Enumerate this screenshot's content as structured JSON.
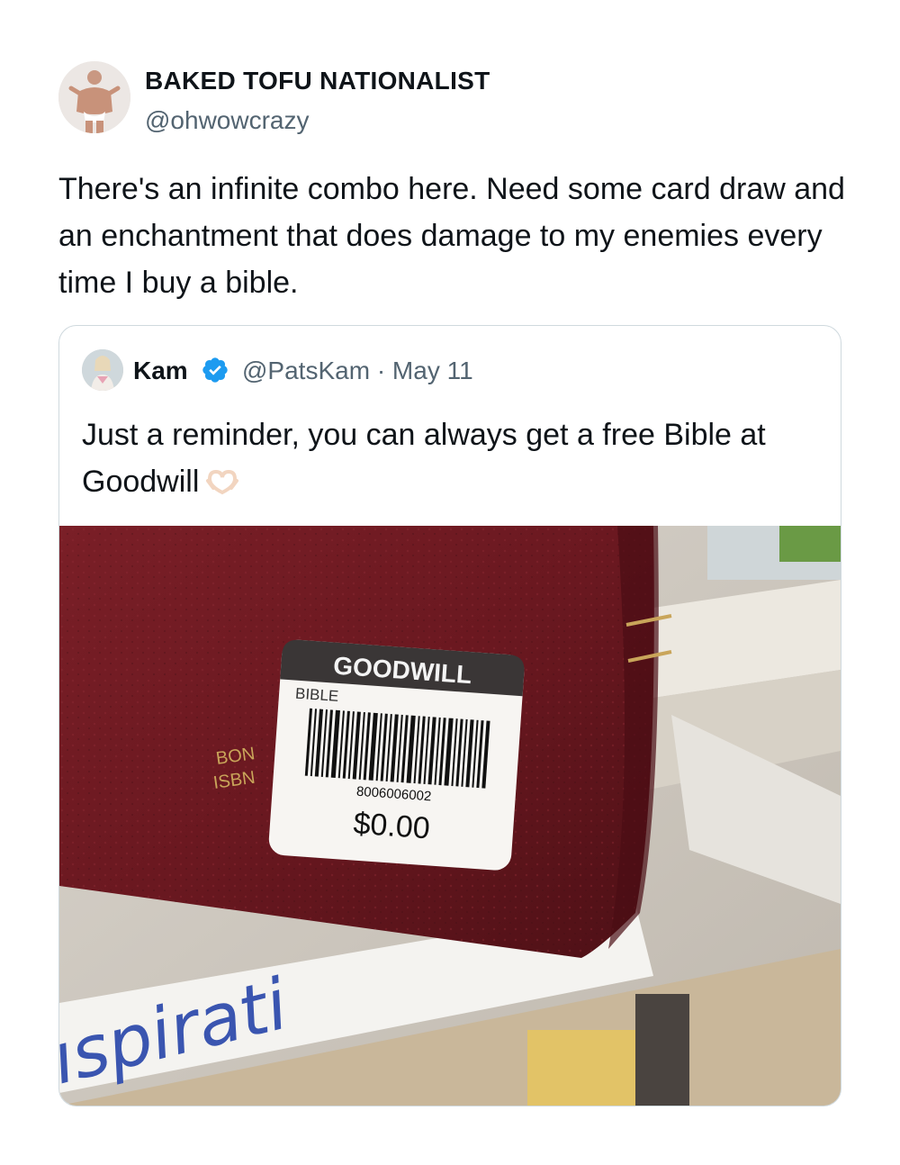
{
  "tweet": {
    "display_name": "BAKED TOFU NATIONALIST",
    "handle": "@ohwowcrazy",
    "text": "There's an infinite combo here. Need some card draw and an enchantment that does damage to my enemies every time I buy a bible.",
    "avatar_icon": "profile-photo"
  },
  "quote": {
    "name": "Kam",
    "verified_icon": "verified-badge-icon",
    "handle": "@PatsKam",
    "separator": "·",
    "date": "May 11",
    "text": "Just a reminder, you can always get a free Bible at Goodwill",
    "emoji": "heart-hands-emoji",
    "photo": {
      "label_brand": "GOODWILL",
      "label_item": "BIBLE",
      "barcode_number": "8006006002",
      "price": "$0.00",
      "book_spine_text": [
        "BON",
        "ISBN"
      ],
      "shelf_sign_text": "ıspirati"
    }
  },
  "colors": {
    "text_primary": "#0f1419",
    "text_secondary": "#536471",
    "border": "#cfd9de",
    "verified_blue": "#1d9bf0",
    "book_red": "#6e1a22"
  }
}
